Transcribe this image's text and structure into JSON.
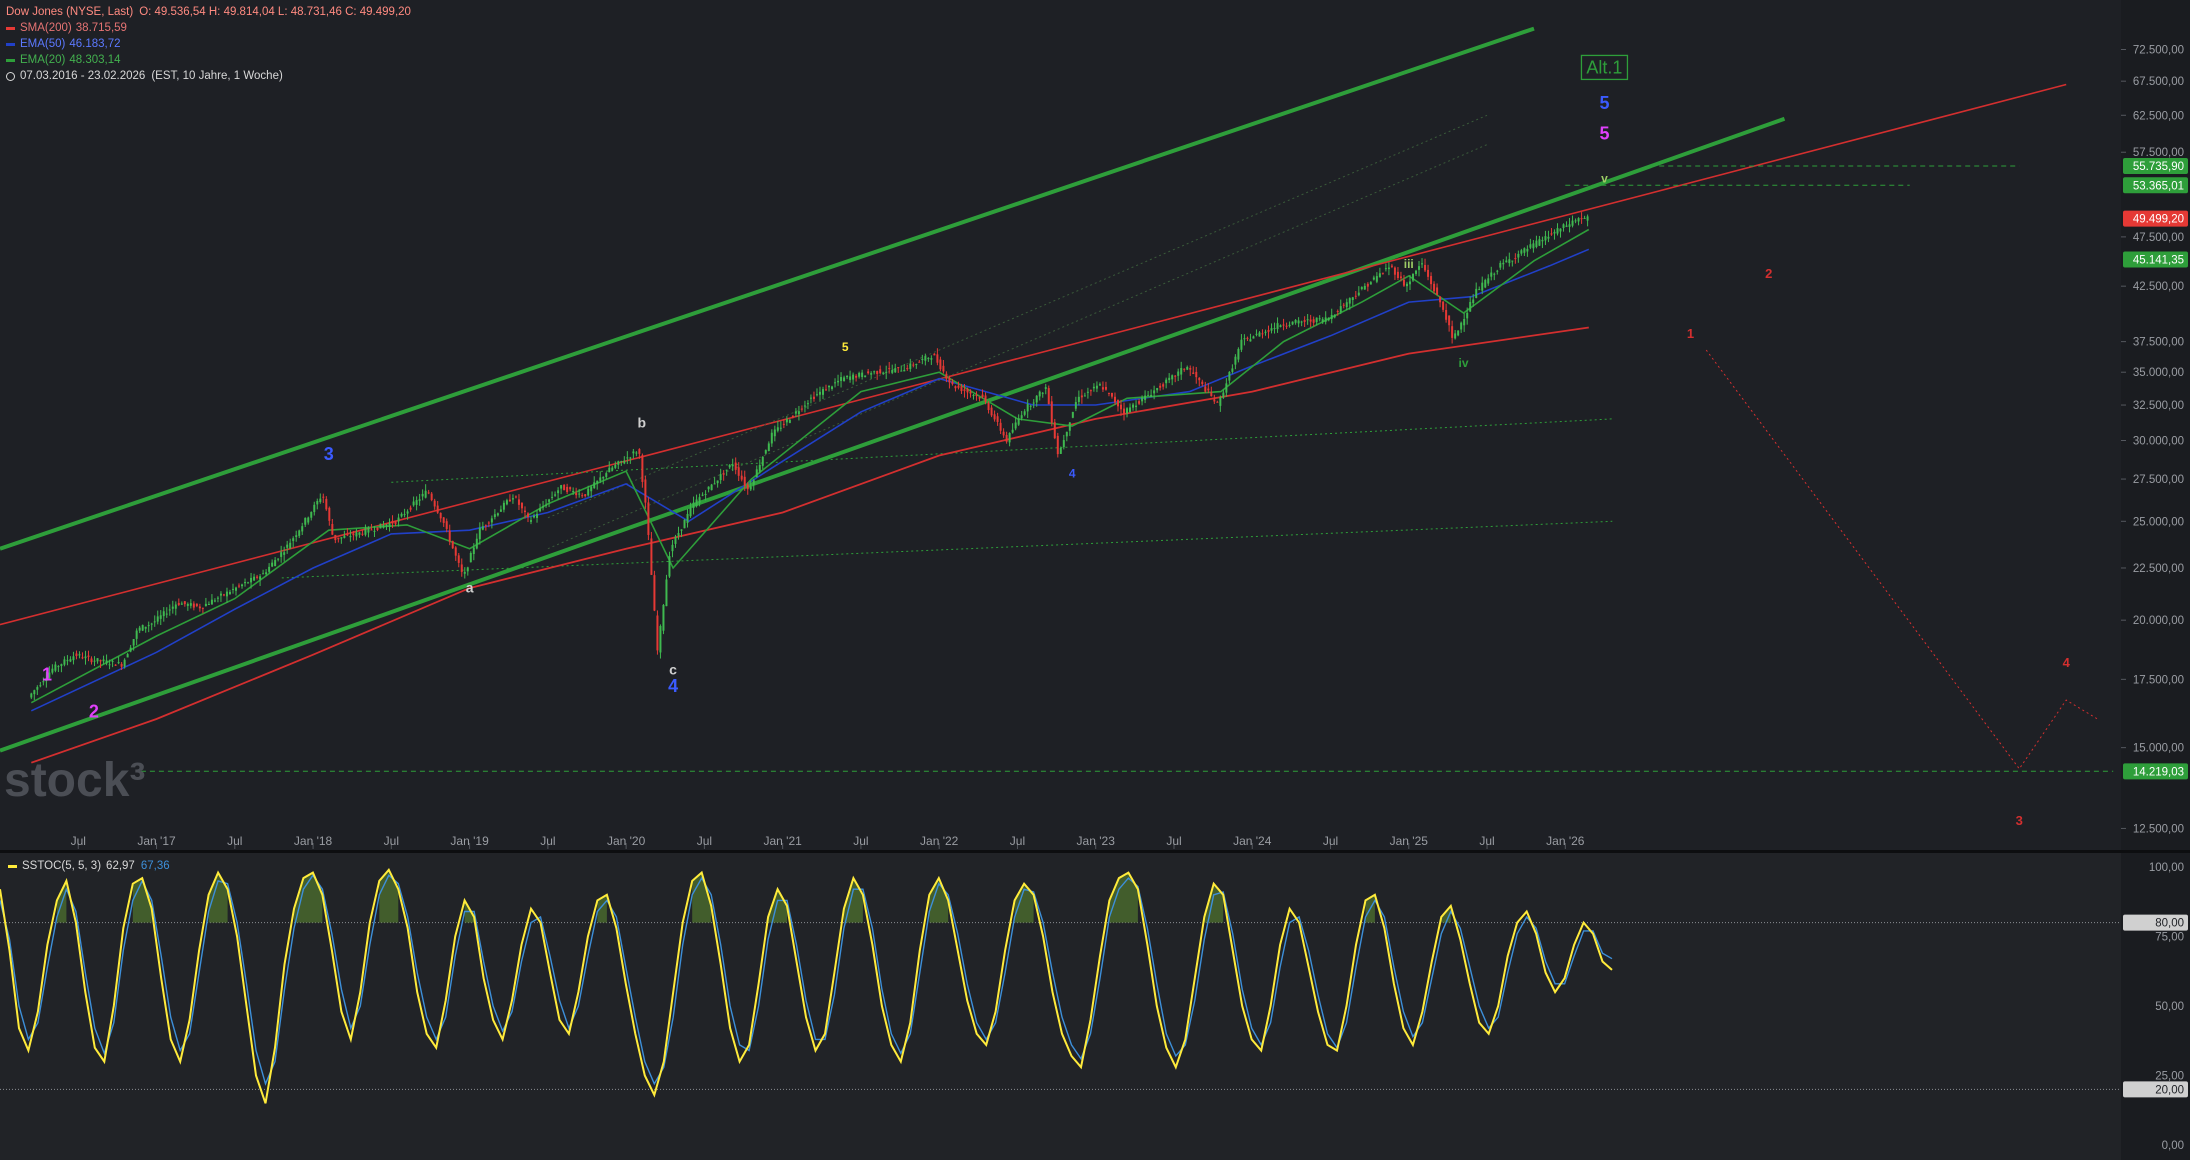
{
  "header": {
    "instrument": "Dow Jones (NYSE, Last)",
    "ohlc": "O: 49.536,54  H: 49.814,04  L: 48.731,46  C: 49.499,20",
    "indicators": [
      {
        "label": "SMA(200)",
        "value": "38.715,59",
        "color": "#e53935"
      },
      {
        "label": "EMA(50)",
        "value": "46.183,72",
        "color": "#2140c8"
      },
      {
        "label": "EMA(20)",
        "value": "48.303,14",
        "color": "#2e9e3a"
      }
    ],
    "range": "07.03.2016 - 23.02.2026",
    "settings": "(EST, 10 Jahre, 1 Woche)"
  },
  "watermark": "stock³",
  "stoch": {
    "label": "SSTOC(5, 5, 3)",
    "k": "62,97",
    "d": "67,36"
  },
  "colors": {
    "bg": "#1e2025",
    "axis_bg": "#1a1c20",
    "up": "#3fb950",
    "down": "#e53935",
    "channel": "#2e9e3a",
    "stoch_k": "#ffeb3b",
    "stoch_d": "#3d8fd9"
  },
  "chart_data": {
    "type": "line",
    "title": "Dow Jones (NYSE, Last)",
    "x_ticks": [
      "Jul",
      "Jan '17",
      "Jul",
      "Jan '18",
      "Jul",
      "Jan '19",
      "Jul",
      "Jan '20",
      "Jul",
      "Jan '21",
      "Jul",
      "Jan '22",
      "Jul",
      "Jan '23",
      "Jul",
      "Jan '24",
      "Jul",
      "Jan '25",
      "Jul",
      "Jan '26"
    ],
    "y_scale": "log",
    "y_ticks": [
      "72.500,00",
      "67.500,00",
      "62.500,00",
      "57.500,00",
      "47.500,00",
      "42.500,00",
      "37.500,00",
      "35.000,00",
      "32.500,00",
      "30.000,00",
      "27.500,00",
      "25.000,00",
      "22.500,00",
      "20.000,00",
      "17.500,00",
      "15.000,00",
      "12.500,00"
    ],
    "y_tick_values": [
      72500,
      67500,
      62500,
      57500,
      47500,
      42500,
      37500,
      35000,
      32500,
      30000,
      27500,
      25000,
      22500,
      20000,
      17500,
      15000,
      12500
    ],
    "price_labels": [
      {
        "text": "55.735,90",
        "value": 55735.9,
        "color": "#2e9e3a"
      },
      {
        "text": "53.365,01",
        "value": 53365.01,
        "color": "#2e9e3a"
      },
      {
        "text": "49.499,20",
        "value": 49499.2,
        "color": "#e53935"
      },
      {
        "text": "45.141,35",
        "value": 45141.35,
        "color": "#2e9e3a"
      },
      {
        "text": "14.219,03",
        "value": 14219.03,
        "color": "#2e9e3a"
      }
    ],
    "price_path": [
      [
        2016.2,
        16800
      ],
      [
        2016.35,
        17900
      ],
      [
        2016.5,
        18500
      ],
      [
        2016.6,
        18300
      ],
      [
        2016.8,
        18100
      ],
      [
        2016.9,
        19600
      ],
      [
        2017.0,
        19900
      ],
      [
        2017.15,
        20800
      ],
      [
        2017.3,
        20600
      ],
      [
        2017.5,
        21400
      ],
      [
        2017.7,
        22200
      ],
      [
        2017.85,
        23600
      ],
      [
        2017.95,
        24800
      ],
      [
        2018.08,
        26600
      ],
      [
        2018.15,
        24000
      ],
      [
        2018.3,
        24300
      ],
      [
        2018.55,
        25000
      ],
      [
        2018.75,
        26800
      ],
      [
        2018.85,
        25000
      ],
      [
        2018.98,
        22000
      ],
      [
        2019.08,
        24500
      ],
      [
        2019.3,
        26500
      ],
      [
        2019.4,
        25000
      ],
      [
        2019.6,
        27000
      ],
      [
        2019.75,
        26500
      ],
      [
        2019.9,
        28000
      ],
      [
        2020.1,
        29400
      ],
      [
        2020.15,
        25400
      ],
      [
        2020.22,
        18600
      ],
      [
        2020.3,
        23500
      ],
      [
        2020.45,
        26000
      ],
      [
        2020.7,
        28500
      ],
      [
        2020.8,
        26800
      ],
      [
        2020.95,
        30400
      ],
      [
        2021.2,
        33000
      ],
      [
        2021.4,
        34500
      ],
      [
        2021.6,
        35000
      ],
      [
        2021.8,
        35300
      ],
      [
        2021.98,
        36400
      ],
      [
        2022.1,
        34000
      ],
      [
        2022.3,
        33000
      ],
      [
        2022.45,
        30000
      ],
      [
        2022.55,
        32000
      ],
      [
        2022.7,
        33800
      ],
      [
        2022.78,
        29000
      ],
      [
        2022.9,
        33000
      ],
      [
        2023.05,
        34000
      ],
      [
        2023.2,
        32000
      ],
      [
        2023.5,
        34500
      ],
      [
        2023.6,
        35500
      ],
      [
        2023.8,
        32500
      ],
      [
        2023.95,
        37500
      ],
      [
        2024.2,
        39000
      ],
      [
        2024.5,
        39500
      ],
      [
        2024.7,
        42000
      ],
      [
        2024.9,
        44500
      ],
      [
        2025.0,
        42500
      ],
      [
        2025.1,
        44800
      ],
      [
        2025.25,
        40000
      ],
      [
        2025.3,
        37600
      ],
      [
        2025.45,
        42000
      ],
      [
        2025.6,
        44500
      ],
      [
        2025.8,
        46500
      ],
      [
        2026.0,
        48500
      ],
      [
        2026.1,
        49500
      ],
      [
        2026.15,
        49499
      ]
    ],
    "series": [
      {
        "name": "SMA(200)",
        "points": [
          [
            2016.2,
            14500
          ],
          [
            2017.0,
            16000
          ],
          [
            2018.0,
            18500
          ],
          [
            2019.0,
            21500
          ],
          [
            2020.0,
            23500
          ],
          [
            2021.0,
            25500
          ],
          [
            2022.0,
            29000
          ],
          [
            2023.0,
            31500
          ],
          [
            2024.0,
            33500
          ],
          [
            2025.0,
            36500
          ],
          [
            2026.15,
            38715
          ]
        ]
      },
      {
        "name": "EMA(50)",
        "points": [
          [
            2016.2,
            16300
          ],
          [
            2017.0,
            18600
          ],
          [
            2017.5,
            20500
          ],
          [
            2018.0,
            22500
          ],
          [
            2018.5,
            24300
          ],
          [
            2019.0,
            24500
          ],
          [
            2019.5,
            25500
          ],
          [
            2020.0,
            27200
          ],
          [
            2020.4,
            25000
          ],
          [
            2020.9,
            28000
          ],
          [
            2021.5,
            32000
          ],
          [
            2022.0,
            34500
          ],
          [
            2022.6,
            32500
          ],
          [
            2023.0,
            32500
          ],
          [
            2023.6,
            33500
          ],
          [
            2024.0,
            35500
          ],
          [
            2024.5,
            38000
          ],
          [
            2025.0,
            41000
          ],
          [
            2025.4,
            41500
          ],
          [
            2025.9,
            44500
          ],
          [
            2026.15,
            46183
          ]
        ]
      },
      {
        "name": "EMA(20)",
        "points": [
          [
            2016.2,
            16600
          ],
          [
            2017.0,
            19300
          ],
          [
            2017.5,
            21000
          ],
          [
            2018.1,
            24500
          ],
          [
            2018.6,
            24800
          ],
          [
            2019.0,
            23500
          ],
          [
            2019.5,
            26000
          ],
          [
            2020.0,
            28000
          ],
          [
            2020.3,
            22500
          ],
          [
            2020.8,
            27500
          ],
          [
            2021.5,
            33500
          ],
          [
            2022.0,
            35000
          ],
          [
            2022.5,
            31500
          ],
          [
            2022.85,
            31000
          ],
          [
            2023.2,
            33000
          ],
          [
            2023.8,
            33500
          ],
          [
            2024.2,
            37500
          ],
          [
            2024.7,
            41000
          ],
          [
            2025.0,
            43500
          ],
          [
            2025.35,
            40000
          ],
          [
            2025.8,
            45000
          ],
          [
            2026.15,
            48303
          ]
        ]
      }
    ],
    "trendlines": [
      {
        "kind": "channel",
        "from": [
          2016.0,
          23500
        ],
        "to": [
          2025.8,
          76000
        ],
        "color": "#2e9e3a",
        "width": 4
      },
      {
        "kind": "channel",
        "from": [
          2016.0,
          14900
        ],
        "to": [
          2027.4,
          62000
        ],
        "color": "#2e9e3a",
        "width": 4
      },
      {
        "kind": "regression",
        "from": [
          2016.0,
          19800
        ],
        "to": [
          2029.2,
          67000
        ],
        "color": "#d32f2f",
        "width": 1.6
      },
      {
        "kind": "dotted",
        "from": [
          2017.8,
          22000
        ],
        "to": [
          2026.3,
          25000
        ],
        "color": "#2e9e3a",
        "width": 1
      },
      {
        "kind": "dotted",
        "from": [
          2018.5,
          27300
        ],
        "to": [
          2026.3,
          31500
        ],
        "color": "#2e9e3a",
        "width": 1
      },
      {
        "kind": "dotted",
        "from": [
          2019.5,
          25200
        ],
        "to": [
          2025.5,
          62500
        ],
        "color": "#3a5a3a",
        "width": 1
      },
      {
        "kind": "dotted",
        "from": [
          2019.5,
          23500
        ],
        "to": [
          2025.5,
          58500
        ],
        "color": "#3a5a3a",
        "width": 1
      },
      {
        "kind": "projection",
        "points": [
          [
            2026.9,
            36800
          ],
          [
            2028.9,
            14300
          ],
          [
            2029.2,
            16700
          ],
          [
            2029.4,
            16000
          ]
        ],
        "color": "#d32f2f",
        "width": 1
      },
      {
        "kind": "target",
        "from": [
          2026.6,
          55735.9
        ],
        "to": [
          2028.9,
          55735.9
        ],
        "color": "#2e9e3a",
        "width": 1
      },
      {
        "kind": "target",
        "from": [
          2026.0,
          53365.01
        ],
        "to": [
          2028.2,
          53365.01
        ],
        "color": "#2e9e3a",
        "width": 1
      },
      {
        "kind": "target",
        "from": [
          2016.9,
          14219.03
        ],
        "to": [
          2029.5,
          14219.03
        ],
        "color": "#2e9e3a",
        "width": 1
      }
    ],
    "wave_labels": [
      {
        "text": "1",
        "x": 2016.3,
        "y": 17450,
        "color": "#e040fb",
        "size": 18
      },
      {
        "text": "2",
        "x": 2016.6,
        "y": 16050,
        "color": "#e040fb",
        "size": 18
      },
      {
        "text": "3",
        "x": 2018.1,
        "y": 28700,
        "color": "#3b5bff",
        "size": 18
      },
      {
        "text": "a",
        "x": 2019.0,
        "y": 21300,
        "color": "#cfcfcf",
        "size": 14
      },
      {
        "text": "b",
        "x": 2020.1,
        "y": 30900,
        "color": "#cfcfcf",
        "size": 14
      },
      {
        "text": "c",
        "x": 2020.3,
        "y": 17700,
        "color": "#cfcfcf",
        "size": 14
      },
      {
        "text": "4",
        "x": 2020.3,
        "y": 17000,
        "color": "#3b5bff",
        "size": 18
      },
      {
        "text": "5",
        "x": 2021.4,
        "y": 36700,
        "color": "#ffeb3b",
        "size": 12
      },
      {
        "text": "4",
        "x": 2022.85,
        "y": 27600,
        "color": "#3b5bff",
        "size": 12
      },
      {
        "text": "iii",
        "x": 2025.0,
        "y": 44300,
        "color": "#9ccc65",
        "size": 12
      },
      {
        "text": "iv",
        "x": 2025.35,
        "y": 35400,
        "color": "#2e9e3a",
        "size": 12
      },
      {
        "text": "5",
        "x": 2026.25,
        "y": 63400,
        "color": "#3b5bff",
        "size": 18
      },
      {
        "text": "5",
        "x": 2026.25,
        "y": 59200,
        "color": "#e040fb",
        "size": 18
      },
      {
        "text": "v",
        "x": 2026.25,
        "y": 53700,
        "color": "#9ccc65",
        "size": 12
      },
      {
        "text": "2",
        "x": 2027.3,
        "y": 43300,
        "color": "#d32f2f",
        "size": 13
      },
      {
        "text": "1",
        "x": 2026.8,
        "y": 37800,
        "color": "#d32f2f",
        "size": 13
      },
      {
        "text": "4",
        "x": 2029.2,
        "y": 18000,
        "color": "#d32f2f",
        "size": 13
      },
      {
        "text": "3",
        "x": 2028.9,
        "y": 12600,
        "color": "#d32f2f",
        "size": 13
      }
    ],
    "badge": {
      "text": "Alt.1",
      "x": 2026.25,
      "y": 69000,
      "color": "#2e9e3a"
    }
  },
  "stoch_data": {
    "type": "line",
    "ylim": [
      0,
      100
    ],
    "y_ticks": [
      "100,00",
      "75,00",
      "50,00",
      "25,00",
      "0,00"
    ],
    "y_tick_values": [
      100,
      75,
      50,
      25,
      0
    ],
    "levels": [
      {
        "text": "80,00",
        "value": 80
      },
      {
        "text": "20,00",
        "value": 20
      }
    ],
    "k": [
      92,
      70,
      42,
      34,
      48,
      72,
      88,
      95,
      80,
      55,
      35,
      30,
      50,
      78,
      94,
      96,
      85,
      60,
      38,
      30,
      45,
      70,
      90,
      98,
      92,
      75,
      50,
      25,
      15,
      35,
      65,
      85,
      96,
      98,
      90,
      70,
      48,
      38,
      55,
      80,
      95,
      99,
      92,
      78,
      55,
      40,
      35,
      52,
      75,
      88,
      82,
      60,
      45,
      38,
      52,
      72,
      85,
      80,
      62,
      45,
      40,
      55,
      75,
      88,
      90,
      78,
      58,
      40,
      25,
      18,
      30,
      55,
      80,
      95,
      98,
      86,
      65,
      42,
      30,
      36,
      58,
      82,
      92,
      86,
      66,
      46,
      34,
      40,
      62,
      85,
      96,
      90,
      72,
      50,
      36,
      30,
      44,
      70,
      90,
      96,
      88,
      70,
      52,
      40,
      36,
      48,
      70,
      88,
      94,
      90,
      75,
      55,
      40,
      32,
      28,
      45,
      68,
      88,
      96,
      98,
      92,
      72,
      50,
      35,
      28,
      38,
      60,
      82,
      94,
      90,
      70,
      50,
      38,
      34,
      50,
      72,
      85,
      80,
      64,
      48,
      36,
      34,
      50,
      72,
      88,
      90,
      78,
      58,
      42,
      36,
      48,
      66,
      82,
      86,
      74,
      58,
      44,
      40,
      50,
      68,
      80,
      84,
      76,
      62,
      55,
      60,
      72,
      80,
      76,
      66,
      63
    ],
    "d": [
      88,
      74,
      50,
      38,
      44,
      64,
      82,
      92,
      84,
      62,
      42,
      33,
      44,
      70,
      88,
      95,
      88,
      68,
      46,
      34,
      40,
      62,
      84,
      95,
      94,
      80,
      58,
      34,
      22,
      30,
      56,
      78,
      92,
      97,
      92,
      76,
      56,
      42,
      50,
      72,
      90,
      97,
      94,
      82,
      62,
      46,
      38,
      46,
      68,
      84,
      84,
      66,
      50,
      41,
      48,
      66,
      80,
      82,
      68,
      52,
      42,
      50,
      68,
      84,
      88,
      82,
      64,
      46,
      30,
      22,
      28,
      46,
      72,
      90,
      96,
      90,
      72,
      50,
      36,
      34,
      50,
      74,
      88,
      88,
      72,
      52,
      38,
      38,
      54,
      78,
      92,
      92,
      78,
      56,
      40,
      33,
      40,
      62,
      84,
      94,
      90,
      76,
      58,
      44,
      38,
      44,
      62,
      82,
      92,
      91,
      80,
      62,
      46,
      36,
      31,
      40,
      60,
      82,
      92,
      96,
      93,
      78,
      58,
      40,
      32,
      36,
      52,
      74,
      90,
      91,
      76,
      56,
      42,
      36,
      44,
      64,
      80,
      82,
      70,
      54,
      40,
      35,
      44,
      64,
      82,
      88,
      82,
      64,
      48,
      39,
      44,
      60,
      76,
      84,
      78,
      64,
      50,
      42,
      46,
      62,
      76,
      82,
      78,
      66,
      58,
      58,
      68,
      77,
      77,
      69,
      67
    ]
  }
}
